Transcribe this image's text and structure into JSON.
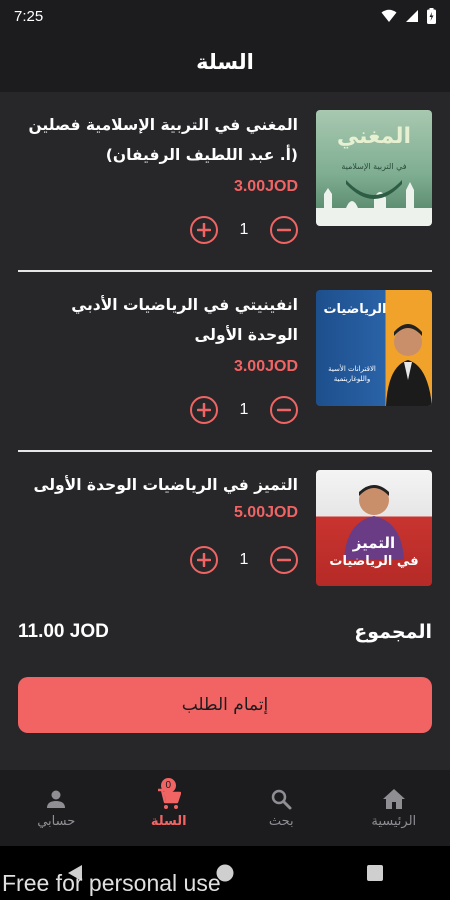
{
  "status_bar": {
    "time": "7:25"
  },
  "app_bar": {
    "title": "السلة"
  },
  "cart_items": [
    {
      "title": "المغني في التربية الإسلامية فصلين (أ. عبد اللطيف الرفيفان)",
      "price": "3.00JOD",
      "quantity": "1",
      "thumb_text": "المغني",
      "thumb_sub": "في التربية الإسلامية"
    },
    {
      "title": "انفينيتي في الرياضيات الأدبي الوحدة الأولى",
      "price": "3.00JOD",
      "quantity": "1",
      "thumb_text": "الرياضيات",
      "thumb_sub": "الاقترانات الأسية واللوغاريتمية"
    },
    {
      "title": "التميز في الرياضيات الوحدة الأولى",
      "price": "5.00JOD",
      "quantity": "1",
      "thumb_text": "التميز",
      "thumb_sub": "في الرياضيات"
    }
  ],
  "total": {
    "label": "المجموع",
    "amount": "11.00 JOD"
  },
  "checkout": {
    "label": "إتمام الطلب"
  },
  "bottom_nav": {
    "items": [
      {
        "label": "الرئيسية",
        "icon": "home-icon"
      },
      {
        "label": "بحث",
        "icon": "search-icon"
      },
      {
        "label": "السلة",
        "icon": "cart-icon",
        "badge": "0"
      },
      {
        "label": "حسابي",
        "icon": "person-icon"
      }
    ]
  },
  "watermark": "Free for personal use",
  "colors": {
    "accent": "#f06464",
    "background": "#27272a",
    "bar": "#1c1c1e"
  }
}
